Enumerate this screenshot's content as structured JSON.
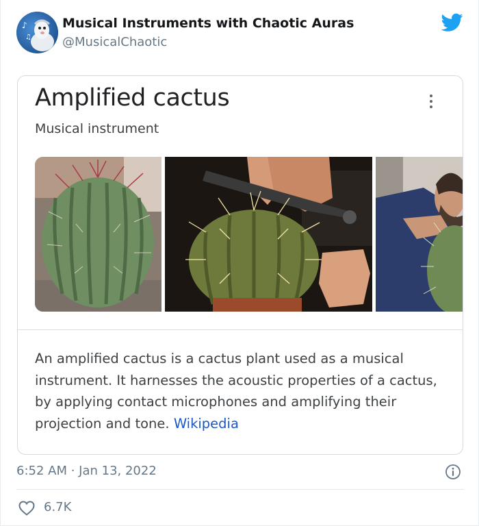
{
  "tweet": {
    "author_name": "Musical Instruments with Chaotic Auras",
    "author_handle": "@MusicalChaotic",
    "timestamp": "6:52 AM · Jan 13, 2022",
    "like_count": "6.7K",
    "brand_color": "#1da1f2"
  },
  "card": {
    "title": "Amplified cactus",
    "subtitle": "Musical instrument",
    "description": "An amplified cactus is a cactus plant used as a musical instrument. It harnesses the acoustic properties of a cactus, by applying contact microphones and amplifying their projection and tone.",
    "source_link": "Wikipedia",
    "link_color": "#1a56c8"
  },
  "icons": {
    "brand": "twitter-bird-icon",
    "menu": "more-vertical-icon",
    "info": "info-icon",
    "like": "heart-outline-icon"
  }
}
